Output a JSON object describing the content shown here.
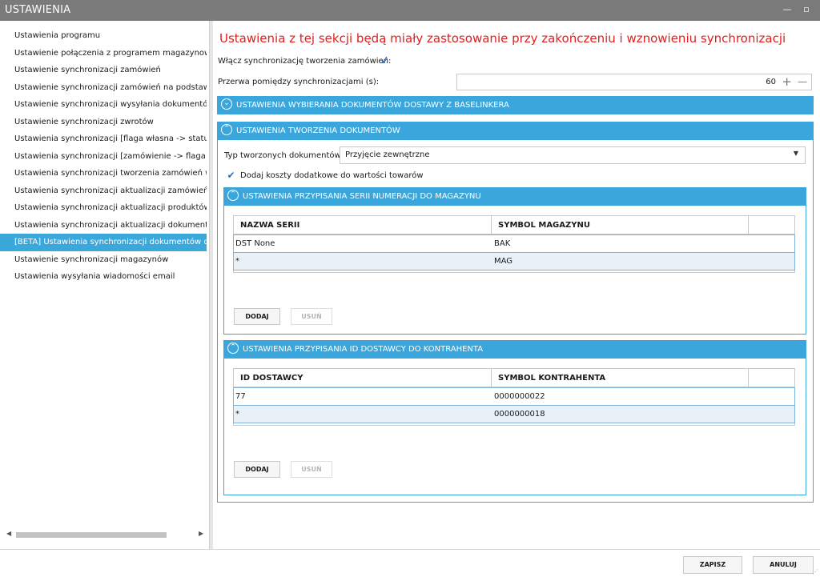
{
  "window": {
    "title": "USTAWIENIA",
    "minimize_glyph": "—",
    "maximize_glyph": "▫"
  },
  "nav": {
    "items": [
      {
        "label": "Ustawienia programu"
      },
      {
        "label": "Ustawienie połączenia z programem magazynowym"
      },
      {
        "label": "Ustawienie synchronizacji zamówień"
      },
      {
        "label": "Ustawienie synchronizacji zamówień na podstawie dzi"
      },
      {
        "label": "Ustawienie synchronizacji wysyłania dokumentów"
      },
      {
        "label": "Ustawienie synchronizacji zwrotów"
      },
      {
        "label": "Ustawienia synchronizacji [flaga własna -> status]"
      },
      {
        "label": "Ustawienia synchronizacji [zamówienie -> flaga własn"
      },
      {
        "label": "Ustawienia synchronizacji tworzenia zamówień w Base"
      },
      {
        "label": "Ustawienia synchronizacji aktualizacji zamówień w Bas"
      },
      {
        "label": "Ustawienia synchronizacji aktualizacji produktów w Ba"
      },
      {
        "label": "Ustawienia synchronizacji aktualizacji dokumentów"
      },
      {
        "label": "[BETA] Ustawienia synchronizacji dokumentów dostaw"
      },
      {
        "label": "Ustawienie synchronizacji magazynów"
      },
      {
        "label": "Ustawienia wysyłania wiadomości email"
      }
    ],
    "selected_index": 12
  },
  "main": {
    "heading": "Ustawienia z tej sekcji będą miały zastosowanie przy zakończeniu i wznowieniu synchronizacji",
    "enable_sync_label": "Włącz synchronizację tworzenia zamówień:",
    "enable_sync_checked": true,
    "interval_label": "Przerwa pomiędzy synchronizacjami (s):",
    "interval_value": "60",
    "plus_glyph": "+",
    "minus_glyph": "—",
    "section_download": {
      "title": "USTAWIENIA WYBIERANIA DOKUMENTÓW DOSTAWY Z BASELINKERA",
      "expanded": false,
      "icon": "chevron-down-icon"
    },
    "section_create": {
      "title": "USTAWIENIA TWORZENIA DOKUMENTÓW",
      "expanded": true,
      "icon": "chevron-up-icon",
      "doc_type_label": "Typ tworzonych dokumentów:",
      "doc_type_value": "Przyjęcie zewnętrzne",
      "extra_costs_label": "Dodaj koszty dodatkowe do wartości towarów",
      "extra_costs_checked": true,
      "series_section": {
        "title": "USTAWIENIA PRZYPISANIA SERII NUMERACJI DO MAGAZYNU",
        "columns": [
          "NAZWA SERII",
          "SYMBOL MAGAZYNU"
        ],
        "rows": [
          [
            "DST None",
            "BAK"
          ],
          [
            "*",
            "MAG"
          ]
        ],
        "add_label": "DODAJ",
        "remove_label": "USUŃ"
      },
      "supplier_section": {
        "title": "USTAWIENIA PRZYPISANIA ID DOSTAWCY DO KONTRAHENTA",
        "columns": [
          "ID DOSTAWCY",
          "SYMBOL KONTRAHENTA"
        ],
        "rows": [
          [
            "77",
            "0000000022"
          ],
          [
            "*",
            "0000000018"
          ]
        ],
        "add_label": "DODAJ",
        "remove_label": "USUŃ"
      }
    }
  },
  "footer": {
    "save_label": "ZAPISZ",
    "cancel_label": "ANULUJ"
  },
  "colors": {
    "accent": "#3aa6dc",
    "heading": "#e02020",
    "titlebar": "#7a7a7a",
    "check": "#2a6fc9"
  }
}
